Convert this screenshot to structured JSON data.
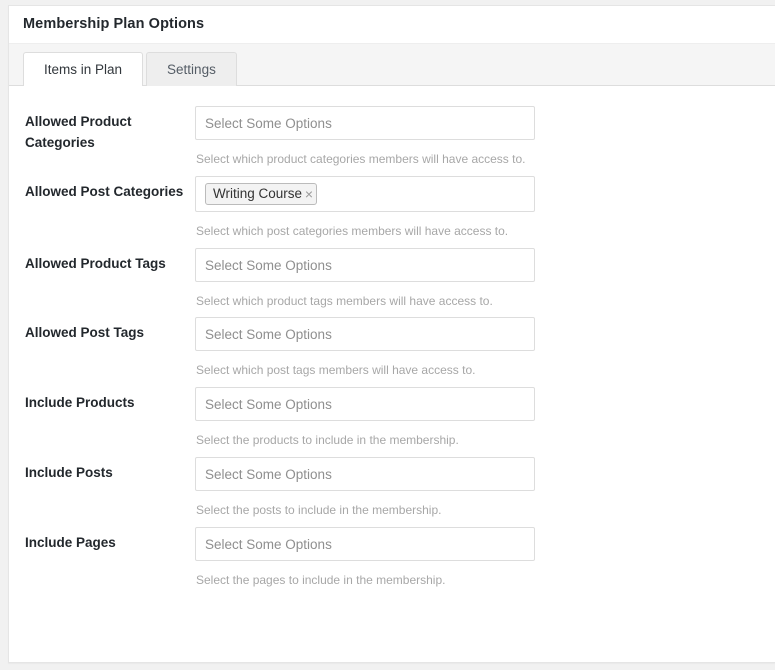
{
  "metabox": {
    "title": "Membership Plan Options"
  },
  "tabs": [
    {
      "label": "Items in Plan",
      "active": true
    },
    {
      "label": "Settings",
      "active": false
    }
  ],
  "fields": [
    {
      "label": "Allowed Product Categories",
      "placeholder": "Select Some Options",
      "description": "Select which product categories members will have access to.",
      "selected": []
    },
    {
      "label": "Allowed Post Categories",
      "placeholder": "Select Some Options",
      "description": "Select which post categories members will have access to.",
      "selected": [
        "Writing Course"
      ]
    },
    {
      "label": "Allowed Product Tags",
      "placeholder": "Select Some Options",
      "description": "Select which product tags members will have access to.",
      "selected": []
    },
    {
      "label": "Allowed Post Tags",
      "placeholder": "Select Some Options",
      "description": "Select which post tags members will have access to.",
      "selected": []
    },
    {
      "label": "Include Products",
      "placeholder": "Select Some Options",
      "description": "Select the products to include in the membership.",
      "selected": []
    },
    {
      "label": "Include Posts",
      "placeholder": "Select Some Options",
      "description": "Select the posts to include in the membership.",
      "selected": []
    },
    {
      "label": "Include Pages",
      "placeholder": "Select Some Options",
      "description": "Select the pages to include in the membership.",
      "selected": []
    }
  ],
  "icons": {
    "chip_remove": "×"
  },
  "colors": {
    "page_background": "#f1f1f1",
    "panel_background": "#ffffff",
    "panel_border": "#e5e5e5",
    "tabbar_background": "#f5f5f5",
    "tab_inactive_background": "#eeeeee",
    "tab_active_background": "#ffffff",
    "label_text": "#23282d",
    "placeholder_text": "#8f8f8f",
    "description_text": "#a7a7a7",
    "input_border": "#dddddd",
    "chip_background": "#f3f3f3",
    "chip_border": "#bbbbbb"
  }
}
